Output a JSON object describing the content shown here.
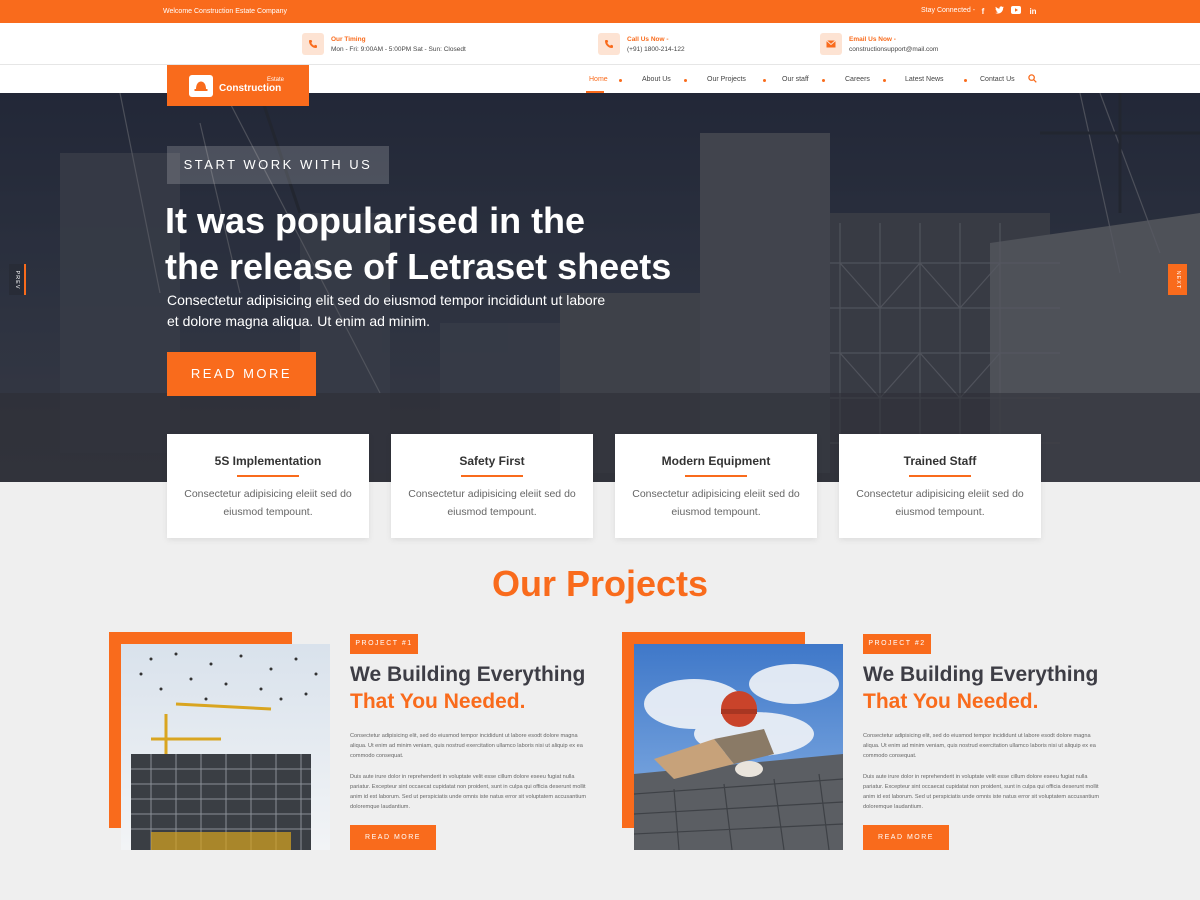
{
  "topbar": {
    "welcome": "Welcome Construction Estate Company",
    "stay_connected": "Stay Connected -",
    "social": [
      "facebook-icon",
      "twitter-icon",
      "youtube-icon",
      "linkedin-icon"
    ]
  },
  "info": [
    {
      "title": "Our Timing",
      "text": "Mon - Fri: 9:00AM - 5:00PM  Sat - Sun: Closedt",
      "icon": "phone-icon"
    },
    {
      "title": "Call Us Now -",
      "text": "(+91) 1800-214-122",
      "icon": "phone-icon"
    },
    {
      "title": "Email Us Now -",
      "text": "constructionsupport@mail.com",
      "icon": "mail-icon"
    }
  ],
  "logo": {
    "title": "Construction",
    "sub": "Estate"
  },
  "nav": {
    "items": [
      "Home",
      "About Us",
      "Our Projects",
      "Our staff",
      "Careers",
      "Latest News",
      "Contact Us"
    ],
    "active": "Home"
  },
  "hero": {
    "badge": "START WORK WITH US",
    "title_line1": "It was popularised in the",
    "title_line2": "the release of Letraset sheets",
    "text": "Consectetur adipisicing elit sed do eiusmod tempor incididunt ut labore et dolore magna aliqua. Ut enim ad minim.",
    "button": "READ MORE",
    "prev": "PREV",
    "next": "NEXT"
  },
  "features": [
    {
      "title": "5S Implementation",
      "text": "Consectetur adipisicing eleiit sed do eiusmod tempount."
    },
    {
      "title": "Safety First",
      "text": "Consectetur adipisicing eleiit sed do eiusmod tempount."
    },
    {
      "title": "Modern Equipment",
      "text": "Consectetur adipisicing eleiit sed do eiusmod tempount."
    },
    {
      "title": "Trained Staff",
      "text": "Consectetur adipisicing eleiit sed do eiusmod tempount."
    }
  ],
  "projects": {
    "title": "Our Projects",
    "items": [
      {
        "tag": "PROJECT #1",
        "heading1": "We Building Everything",
        "heading2": "That You Needed.",
        "p1": "Consectetur adipisicing elit, sed do eiusmod tempor incididunt ut labore esodt dolore magna aliqua. Ut enim ad minim veniam, quis nostrud exercitation ullamco laboris nisi ut aliquip ex ea commodo consequat.",
        "p2": "Duis aute irure dolor in reprehenderit in voluptate velit esse cillum dolore eseeu fugiat nulla pariatur. Excepteur sint occaecat cupidatat non proident, sunt in culpa qui officia deserunt mollit anim id est laborum. Sed ut perspiciatis unde omnis iste natus error sit voluptatem accusantium doloremque laudantium.",
        "button": "READ MORE"
      },
      {
        "tag": "PROJECT #2",
        "heading1": "We Building Everything",
        "heading2": "That You Needed.",
        "p1": "Consectetur adipisicing elit, sed do eiusmod tempor incididunt ut labore esodt dolore magna aliqua. Ut enim ad minim veniam, quis nostrud exercitation ullamco laboris nisi ut aliquip ex ea commodo consequat.",
        "p2": "Duis aute irure dolor in reprehenderit in voluptate velit esse cillum dolore eseeu fugiat nulla pariatur. Excepteur sint occaecat cupidatat non proident, sunt in culpa qui officia deserunt mollit anim id est laborum. Sed ut perspiciatis unde omnis iste natus error sit voluptatem accusantium doloremque laudantium.",
        "button": "READ MORE"
      }
    ]
  },
  "colors": {
    "accent": "#f96b1c",
    "dark": "#3d3d45",
    "background": "#efefef"
  }
}
